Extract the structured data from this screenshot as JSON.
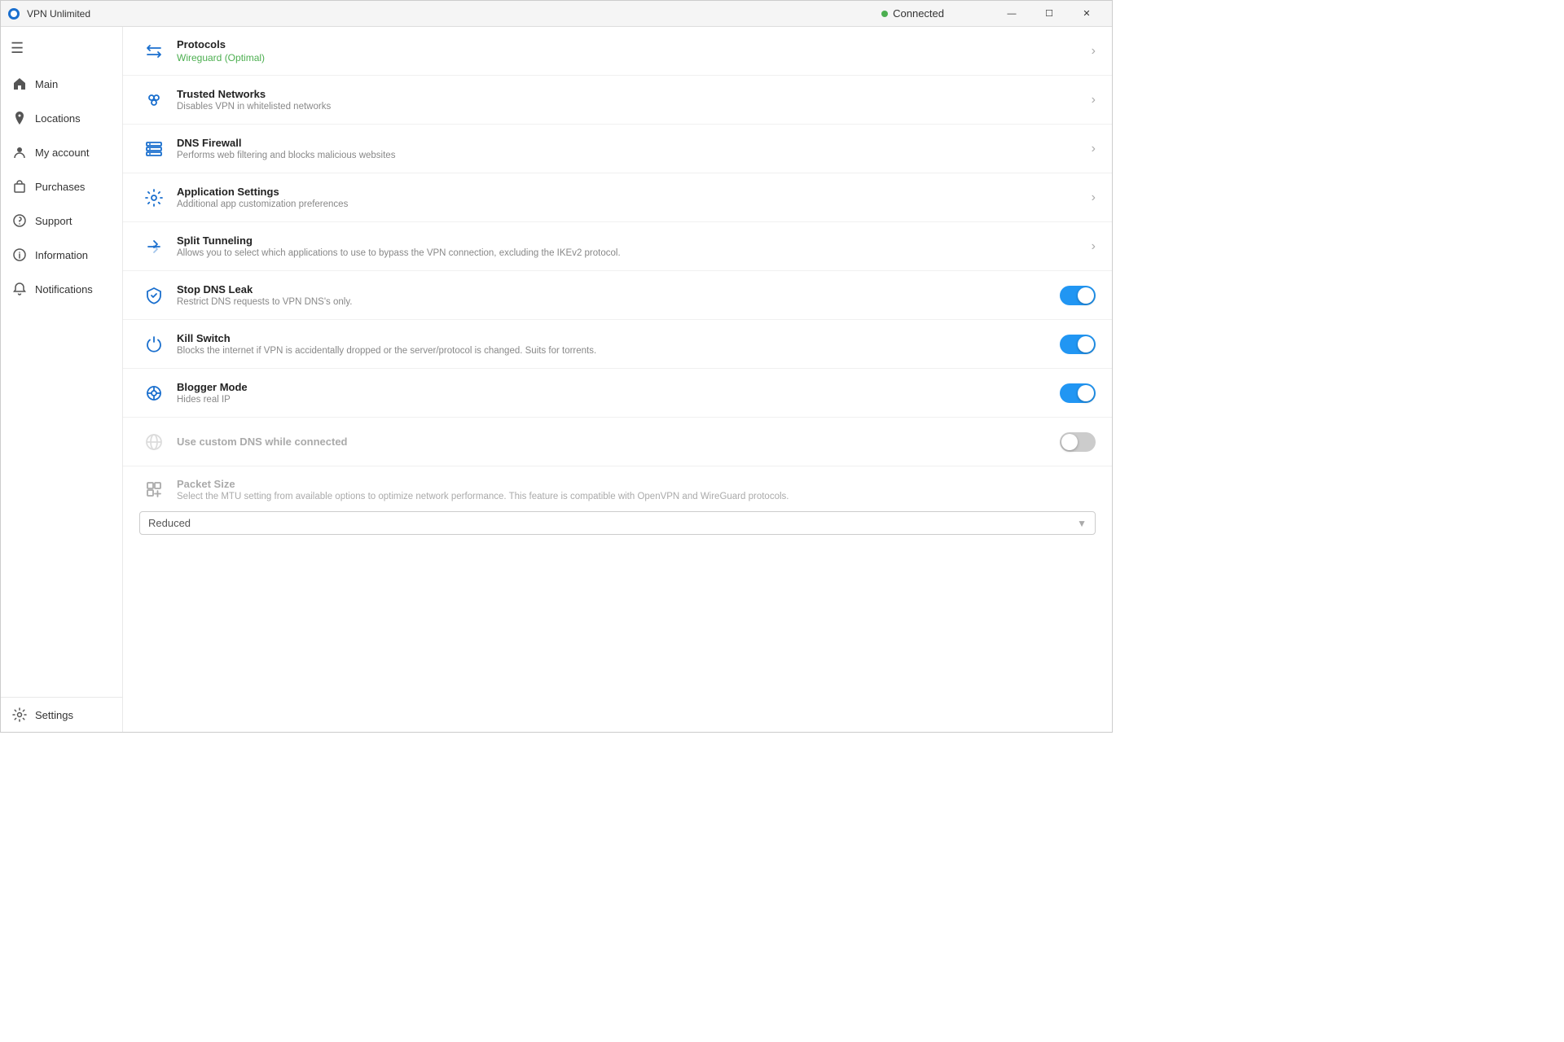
{
  "app": {
    "title": "VPN Unlimited",
    "connected_label": "Connected",
    "connected_color": "#4CAF50"
  },
  "titlebar": {
    "minimize": "—",
    "maximize": "☐",
    "close": "✕"
  },
  "sidebar": {
    "menu_icon": "☰",
    "items": [
      {
        "id": "main",
        "label": "Main",
        "icon": "home"
      },
      {
        "id": "locations",
        "label": "Locations",
        "icon": "location"
      },
      {
        "id": "my-account",
        "label": "My account",
        "icon": "person"
      },
      {
        "id": "purchases",
        "label": "Purchases",
        "icon": "bag"
      },
      {
        "id": "support",
        "label": "Support",
        "icon": "support"
      },
      {
        "id": "information",
        "label": "Information",
        "icon": "info"
      },
      {
        "id": "notifications",
        "label": "Notifications",
        "icon": "bell"
      }
    ],
    "bottom": {
      "id": "settings",
      "label": "Settings",
      "icon": "gear"
    }
  },
  "settings": {
    "rows": [
      {
        "id": "protocols",
        "title": "Protocols",
        "desc": "",
        "value": "Wireguard (Optimal)",
        "type": "chevron",
        "icon": "protocol"
      },
      {
        "id": "trusted-networks",
        "title": "Trusted Networks",
        "desc": "Disables VPN in whitelisted networks",
        "type": "chevron",
        "icon": "network"
      },
      {
        "id": "dns-firewall",
        "title": "DNS Firewall",
        "desc": "Performs web filtering and blocks malicious websites",
        "type": "chevron",
        "icon": "dns"
      },
      {
        "id": "app-settings",
        "title": "Application Settings",
        "desc": "Additional app customization preferences",
        "type": "chevron",
        "icon": "gear-settings"
      },
      {
        "id": "split-tunneling",
        "title": "Split Tunneling",
        "desc": "Allows you to select which applications to use to bypass the VPN connection, excluding the IKEv2 protocol.",
        "type": "chevron",
        "icon": "split"
      },
      {
        "id": "stop-dns-leak",
        "title": "Stop DNS Leak",
        "desc": "Restrict DNS requests to VPN DNS's only.",
        "type": "toggle",
        "toggle_state": "on",
        "icon": "shield"
      },
      {
        "id": "kill-switch",
        "title": "Kill Switch",
        "desc": "Blocks the internet if VPN is accidentally dropped or the server/protocol is changed. Suits for torrents.",
        "type": "toggle",
        "toggle_state": "on",
        "icon": "switch"
      },
      {
        "id": "blogger-mode",
        "title": "Blogger Mode",
        "desc": "Hides real IP",
        "type": "toggle",
        "toggle_state": "on",
        "icon": "blogger"
      },
      {
        "id": "custom-dns",
        "title": "Use custom DNS while connected",
        "desc": "",
        "type": "toggle",
        "toggle_state": "off",
        "icon": "globe",
        "disabled": true
      }
    ],
    "packet_size": {
      "title": "Packet Size",
      "desc": "Select the MTU setting from available options to optimize network performance. This feature is compatible with OpenVPN and WireGuard protocols.",
      "value": "Reduced",
      "icon": "packet",
      "disabled": true
    }
  }
}
